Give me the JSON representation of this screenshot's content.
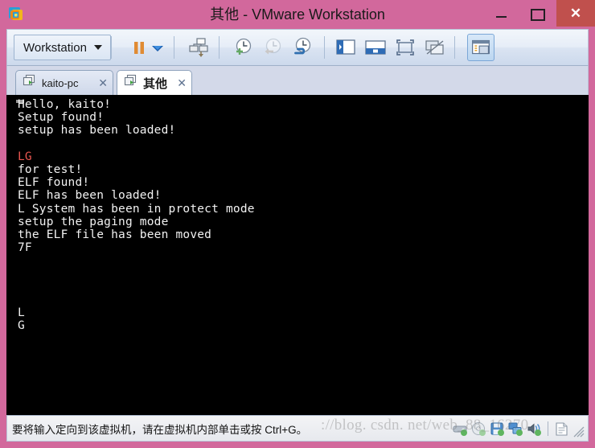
{
  "window": {
    "title": "其他 - VMware Workstation",
    "logo_icon": "vmware-logo-icon",
    "minimize_label": "—",
    "maximize_label": "▢",
    "close_label": "✕",
    "border_color": "#d2689c",
    "close_button_color": "#c0504d"
  },
  "toolbar": {
    "workstation_menu_label": "Workstation",
    "buttons": [
      {
        "name": "pause-vm-button",
        "icon": "pause-icon",
        "tooltip": "Pause"
      },
      {
        "name": "power-dropdown-button",
        "icon": "chevron-down-icon",
        "tooltip": "Power"
      },
      {
        "name": "manage-vm-button",
        "icon": "vm-download-icon",
        "tooltip": "Manage"
      },
      {
        "name": "take-snapshot-button",
        "icon": "clock-plus-icon",
        "tooltip": "Take Snapshot"
      },
      {
        "name": "revert-snapshot-button",
        "icon": "clock-arrow-left-icon",
        "tooltip": "Revert to Snapshot"
      },
      {
        "name": "snapshot-manager-button",
        "icon": "clock-wrench-icon",
        "tooltip": "Snapshot Manager"
      },
      {
        "name": "show-library-button",
        "icon": "sidebar-panel-icon",
        "tooltip": "Show Library"
      },
      {
        "name": "show-thumbnail-bar-button",
        "icon": "thumbnail-bar-icon",
        "tooltip": "Show Thumbnail Bar"
      },
      {
        "name": "full-screen-button",
        "icon": "fullscreen-icon",
        "tooltip": "Enter Full Screen"
      },
      {
        "name": "unity-mode-button",
        "icon": "unity-mode-icon",
        "tooltip": "Unity Mode"
      },
      {
        "name": "console-view-button",
        "icon": "console-view-icon",
        "tooltip": "Console View"
      }
    ]
  },
  "tabs": [
    {
      "label": "kaito-pc",
      "active": false,
      "icon": "vm-tab-icon",
      "close_label": "✕"
    },
    {
      "label": "其他",
      "active": true,
      "icon": "vm-tab-icon",
      "close_label": "✕"
    }
  ],
  "guest": {
    "background_color": "#000000",
    "cursor_color": "#9a9a9a",
    "red_text_color": "#e8564f",
    "lines": [
      {
        "text": "Hello, kaito!",
        "color": "white"
      },
      {
        "text": "Setup found!",
        "color": "white"
      },
      {
        "text": "setup has been loaded!",
        "color": "white"
      },
      {
        "text": "",
        "color": "white"
      },
      {
        "text": "LG",
        "color": "red"
      },
      {
        "text": "for test!",
        "color": "white"
      },
      {
        "text": "ELF found!",
        "color": "white"
      },
      {
        "text": "ELF has been loaded!",
        "color": "white"
      },
      {
        "text": "L System has been in protect mode",
        "color": "white"
      },
      {
        "text": "setup the paging mode",
        "color": "white"
      },
      {
        "text": "the ELF file has been moved",
        "color": "white"
      },
      {
        "text": "7F",
        "color": "white"
      },
      {
        "text": "",
        "color": "white"
      },
      {
        "text": "",
        "color": "white"
      },
      {
        "text": "",
        "color": "white"
      },
      {
        "text": "",
        "color": "white"
      },
      {
        "text": "L",
        "color": "white"
      },
      {
        "text": "G",
        "color": "white"
      }
    ]
  },
  "status_bar": {
    "message": "要将输入定向到该虚拟机，请在虚拟机内部单击或按 Ctrl+G。",
    "icons": [
      {
        "name": "hard-disk-status-icon",
        "label": "Hard Disk"
      },
      {
        "name": "cd-dvd-status-icon",
        "label": "CD/DVD"
      },
      {
        "name": "floppy-status-icon",
        "label": "Floppy"
      },
      {
        "name": "network-adapter-status-icon",
        "label": "Network Adapter"
      },
      {
        "name": "sound-card-status-icon",
        "label": "Sound Card"
      },
      {
        "name": "message-log-status-icon",
        "label": "Message Log"
      }
    ]
  },
  "watermark": {
    "text": "://blog. csdn. net/web_88_16270"
  }
}
